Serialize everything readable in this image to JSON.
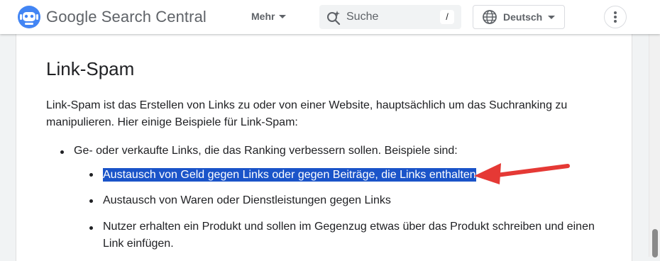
{
  "header": {
    "brand": "Google Search Central",
    "menu_label": "Mehr",
    "search": {
      "placeholder": "Suche",
      "shortcut": "/"
    },
    "language": "Deutsch",
    "icons": [
      "logo-robot-icon",
      "search-sparkle-icon",
      "globe-icon",
      "more-vert-icon"
    ]
  },
  "article": {
    "heading": "Link-Spam",
    "intro": "Link-Spam ist das Erstellen von Links zu oder von einer Website, hauptsächlich um das Suchranking zu manipulieren. Hier einige Beispiele für Link-Spam:",
    "list": {
      "item1": "Ge- oder verkaufte Links, die das Ranking verbessern sollen. Beispiele sind:",
      "subitems": [
        "Austausch von Geld gegen Links oder gegen Beiträge, die Links enthalten",
        "Austausch von Waren oder Dienstleistungen gegen Links",
        "Nutzer erhalten ein Produkt und sollen im Gegenzug etwas über das Produkt schreiben und einen",
        "Link einfügen."
      ]
    }
  },
  "annotation": {
    "arrow_color": "#e53935",
    "highlight_color": "#1a54c9"
  },
  "colors": {
    "brand_text": "#5f6368",
    "body_text": "#202124"
  }
}
